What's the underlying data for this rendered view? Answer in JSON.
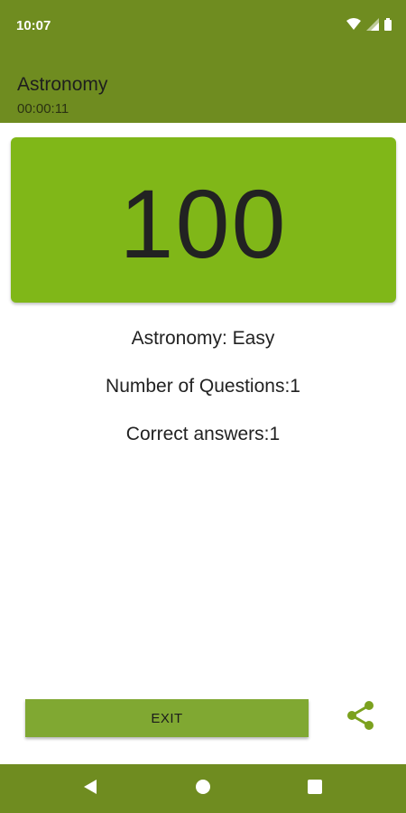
{
  "status_bar": {
    "time": "10:07",
    "icons": [
      "wifi-icon",
      "cellular-signal-icon",
      "battery-icon"
    ]
  },
  "app_bar": {
    "title": "Astronomy",
    "timer": "00:00:11"
  },
  "score": {
    "value": "100"
  },
  "summary": {
    "category": "Astronomy: Easy",
    "questions": "Number of Questions:1",
    "correct": "Correct answers:1"
  },
  "actions": {
    "exit_label": "EXIT",
    "share_icon": "share-icon"
  },
  "nav_bar": {
    "buttons": [
      "back-icon",
      "home-icon",
      "recents-icon"
    ]
  },
  "colors": {
    "primary": "#6f8c20",
    "score_card": "#80b718",
    "button": "#80a832",
    "share_icon": "#7ba11e"
  }
}
